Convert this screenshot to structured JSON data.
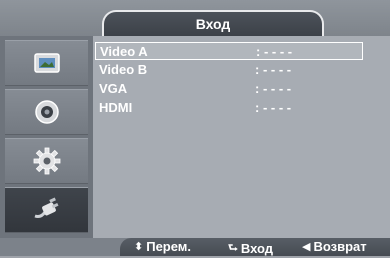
{
  "title": "Вход",
  "sidebar": {
    "items": [
      {
        "icon": "picture-icon",
        "active": false
      },
      {
        "icon": "sound-icon",
        "active": false
      },
      {
        "icon": "settings-gear-icon",
        "active": false
      },
      {
        "icon": "input-plug-icon",
        "active": true
      }
    ]
  },
  "sources": [
    {
      "label": "Video A",
      "value": ": - - - -",
      "selected": true
    },
    {
      "label": "Video B",
      "value": ": - - - -",
      "selected": false
    },
    {
      "label": "VGA",
      "value": ": - - - -",
      "selected": false
    },
    {
      "label": "HDMI",
      "value": ": - - - -",
      "selected": false
    }
  ],
  "footer": {
    "move_glyph": "⬍",
    "move_label": "Перем.",
    "enter_glyph": "⮑",
    "enter_label": "Вход",
    "back_glyph": "◀",
    "back_label": "Возврат"
  },
  "colors": {
    "background": "#a4a9b0",
    "sidebar": "#6e747c",
    "active_item": "#3f444b",
    "text": "#ffffff"
  }
}
